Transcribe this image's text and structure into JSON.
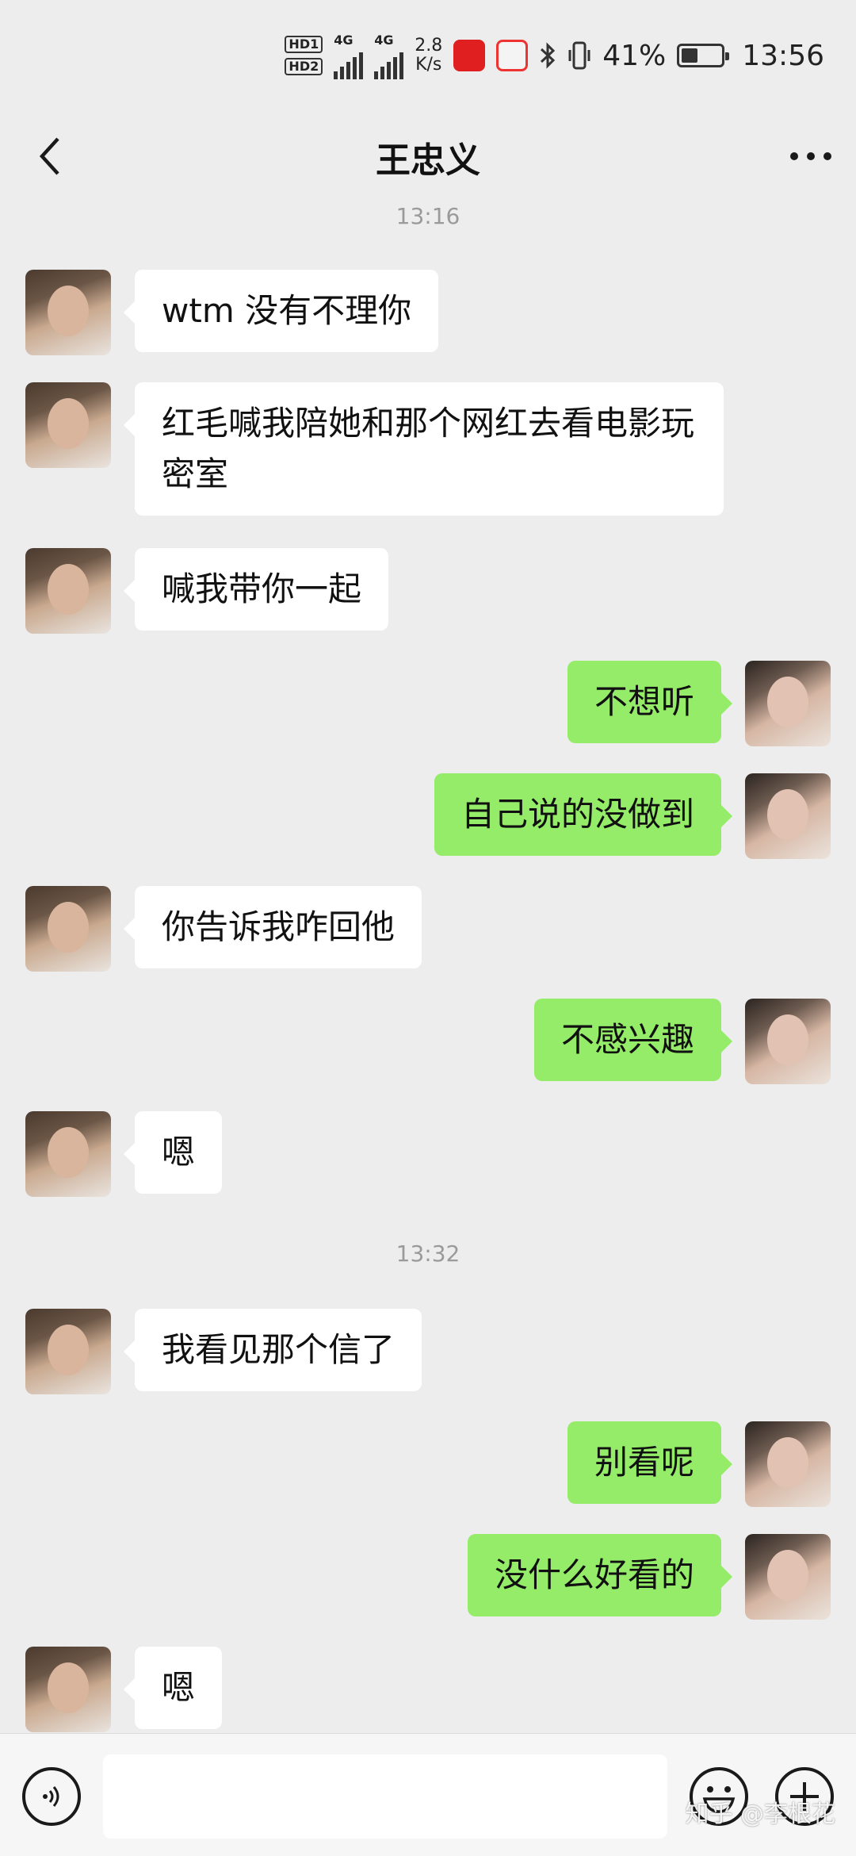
{
  "status_bar": {
    "hd1": "HD1",
    "hd2": "HD2",
    "net1": "4G",
    "net2": "4G",
    "speed_value": "2.8",
    "speed_unit": "K/s",
    "battery_percent": "41%",
    "battery_level": 0.41,
    "time": "13:56"
  },
  "header": {
    "title": "王忠义"
  },
  "chat": {
    "timestamps": [
      "13:16",
      "13:32"
    ],
    "messages": [
      {
        "side": "left",
        "text": "wtm 没有不理你"
      },
      {
        "side": "left",
        "text": "红毛喊我陪她和那个网红去看电影玩密室"
      },
      {
        "side": "left",
        "text": "喊我带你一起"
      },
      {
        "side": "right",
        "text": "不想听"
      },
      {
        "side": "right",
        "text": "自己说的没做到"
      },
      {
        "side": "left",
        "text": "你告诉我咋回他"
      },
      {
        "side": "right",
        "text": "不感兴趣"
      },
      {
        "side": "left",
        "text": "嗯"
      },
      {
        "side": "left",
        "text": "我看见那个信了"
      },
      {
        "side": "right",
        "text": "别看呢"
      },
      {
        "side": "right",
        "text": "没什么好看的"
      },
      {
        "side": "left",
        "text": "嗯"
      }
    ]
  },
  "input": {
    "placeholder": ""
  },
  "watermark": "知乎 @李根花",
  "colors": {
    "background": "#ededed",
    "bubble_self": "#95ec69",
    "bubble_other": "#ffffff"
  }
}
